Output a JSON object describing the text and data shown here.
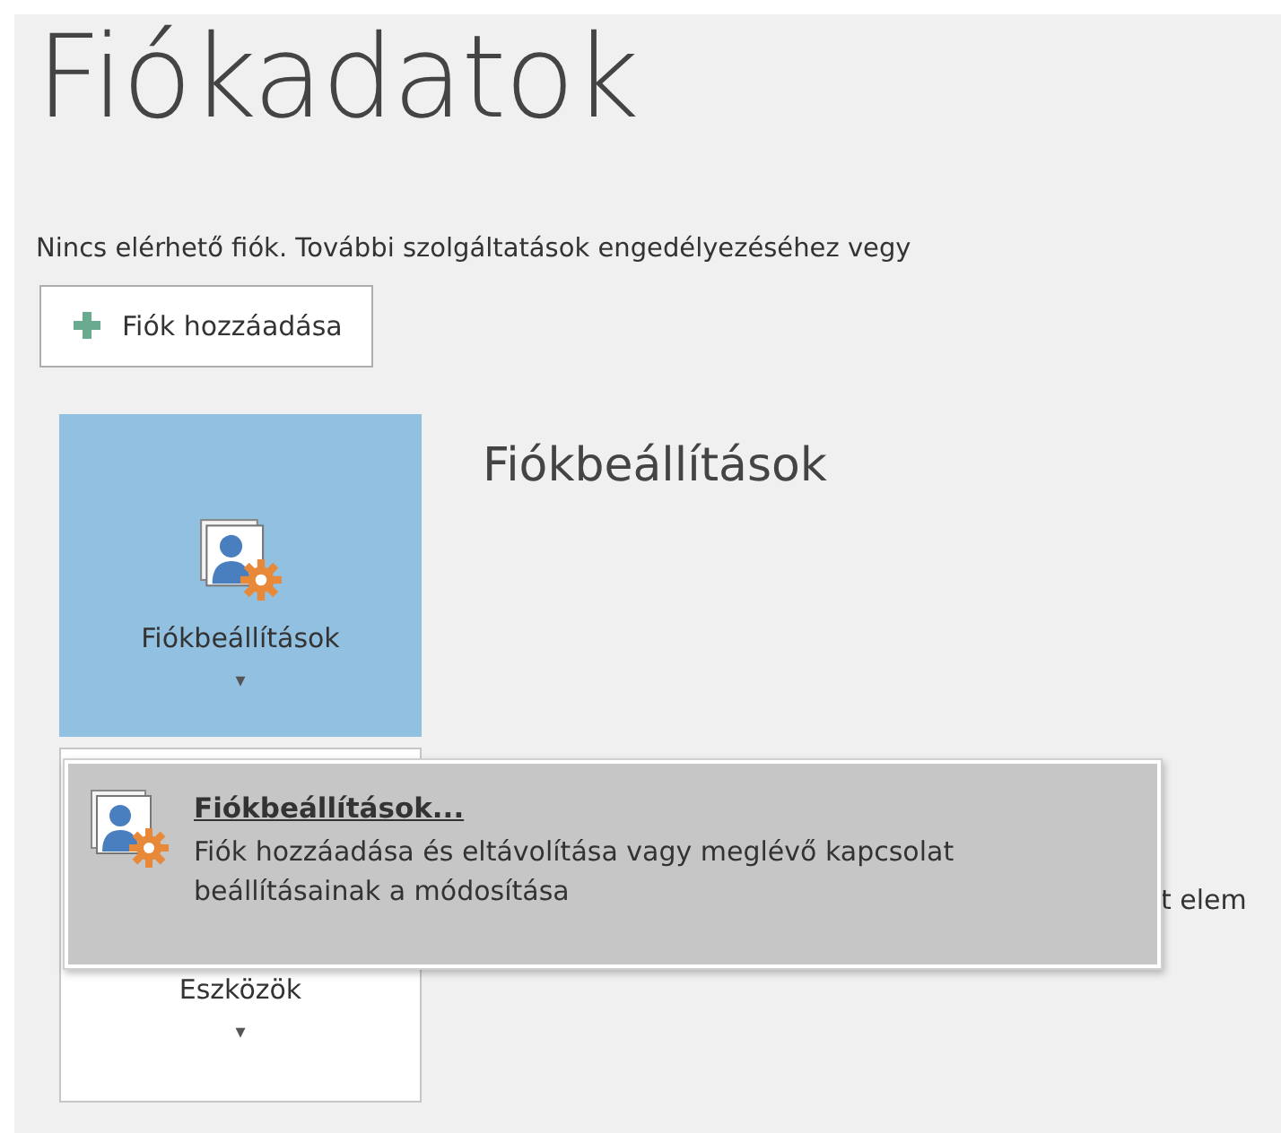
{
  "title": "Fiókadatok",
  "notice": "Nincs elérhető fiók. További szolgáltatások engedélyezéséhez vegy",
  "add_button": {
    "label": "Fiók hozzáadása"
  },
  "sections": [
    {
      "tile": {
        "label": "Fiókbeállítások",
        "caret": "▾",
        "selected": true
      },
      "heading": "Fiókbeállítások"
    },
    {
      "tile": {
        "label": "Eszközök",
        "caret": "▾",
        "selected": false
      },
      "description": "t elem"
    }
  ],
  "dropdown": {
    "items": [
      {
        "title": "Fiókbeállítások...",
        "description": "Fiók hozzáadása és eltávolítása vagy meglévő kapcsolat beállításainak a módosítása",
        "selected": true
      }
    ]
  }
}
